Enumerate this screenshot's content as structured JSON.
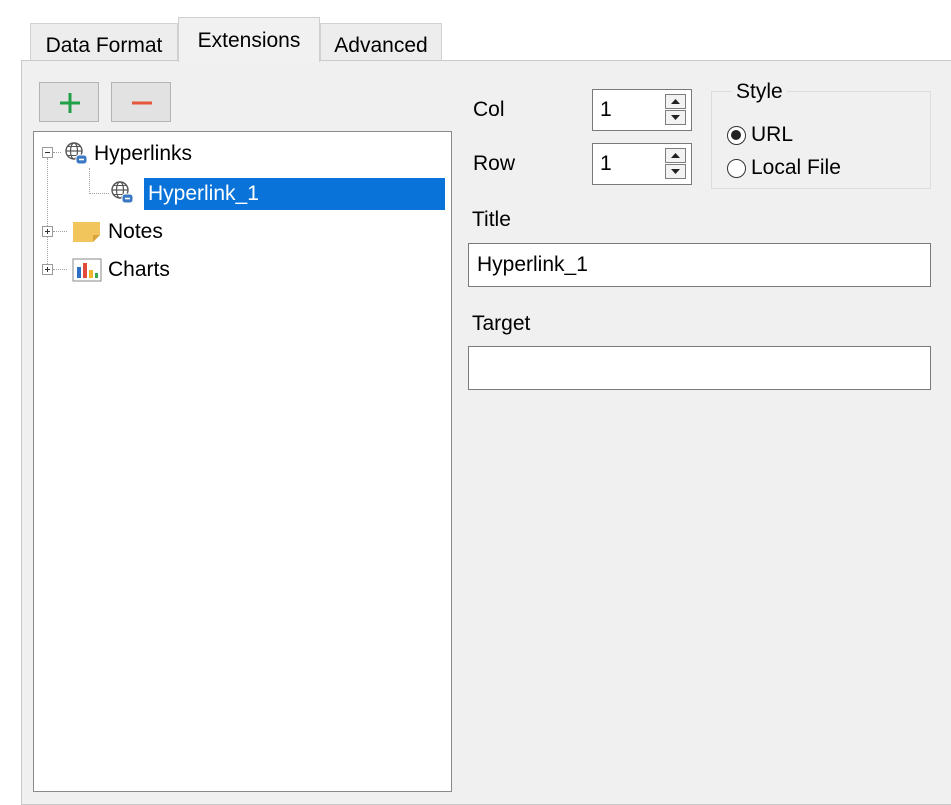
{
  "tabs": [
    {
      "label": "Data Format",
      "active": false
    },
    {
      "label": "Extensions",
      "active": true
    },
    {
      "label": "Advanced",
      "active": false
    }
  ],
  "toolbar": {
    "add_icon": "plus-icon",
    "remove_icon": "minus-icon",
    "add_color": "#21a04a",
    "remove_color": "#e4573d"
  },
  "tree": {
    "items": [
      {
        "label": "Hyperlinks",
        "icon": "globe-link-icon",
        "expanded": true
      },
      {
        "label": "Hyperlink_1",
        "icon": "globe-link-icon",
        "selected": true
      },
      {
        "label": "Notes",
        "icon": "note-icon",
        "expanded": false
      },
      {
        "label": "Charts",
        "icon": "chart-icon",
        "expanded": false
      }
    ],
    "selection_color": "#0a73d9"
  },
  "form": {
    "col_label": "Col",
    "col_value": "1",
    "row_label": "Row",
    "row_value": "1",
    "style": {
      "legend": "Style",
      "options": [
        {
          "label": "URL",
          "checked": true
        },
        {
          "label": "Local File",
          "checked": false
        }
      ]
    },
    "title_label": "Title",
    "title_value": "Hyperlink_1",
    "target_label": "Target",
    "target_value": ""
  }
}
